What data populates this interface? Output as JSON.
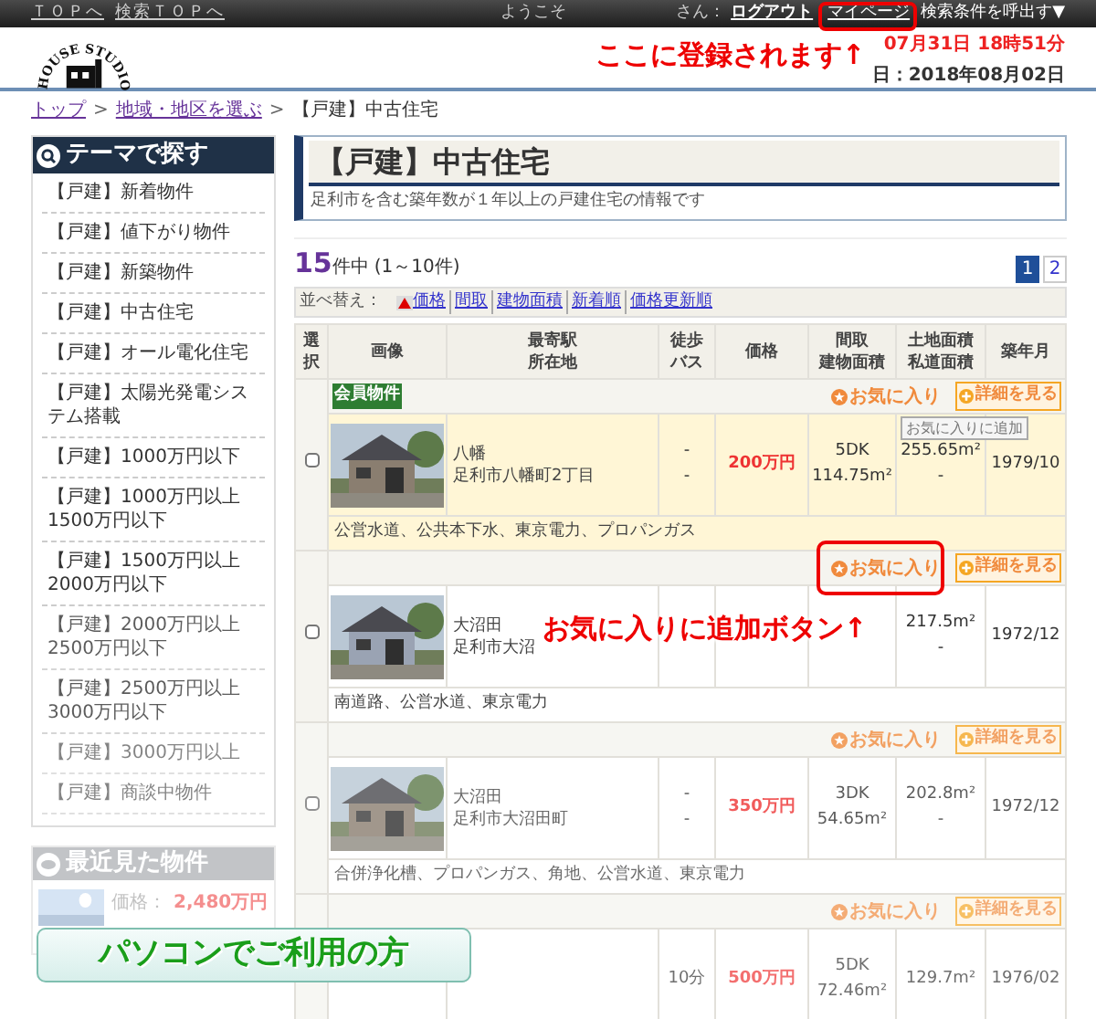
{
  "top_bar": {
    "links": [
      "ＴＯＰへ",
      "検索ＴＯＰへ"
    ],
    "welcome": "ようこそ",
    "san": "さん：",
    "logout": "ログアウト",
    "mypage": "マイページ",
    "saved_search": "検索条件を呼出す▼"
  },
  "header": {
    "logo": "HOUSE STUDIO",
    "update_line": "07月31日 18時51分",
    "next_update_line": "日：2018年08月02日"
  },
  "breadcrumb": {
    "separator": ">",
    "items": [
      {
        "label": "トップ",
        "link": true
      },
      {
        "label": "地域・地区を選ぶ",
        "link": true
      },
      {
        "label": "【戸建】中古住宅",
        "link": false
      }
    ]
  },
  "sidebar": {
    "theme_title": "テーマで探す",
    "items": [
      "【戸建】新着物件",
      "【戸建】値下がり物件",
      "【戸建】新築物件",
      "【戸建】中古住宅",
      "【戸建】オール電化住宅",
      "【戸建】太陽光発電システム搭載",
      "【戸建】1000万円以下",
      "【戸建】1000万円以上1500万円以下",
      "【戸建】1500万円以上2000万円以下",
      "【戸建】2000万円以上2500万円以下",
      "【戸建】2500万円以上3000万円以下",
      "【戸建】3000万円以上",
      "【戸建】商談中物件"
    ],
    "recent_title": "最近見た物件",
    "recent_price_label": "価格：",
    "recent_price": "2,480万円"
  },
  "page": {
    "title": "【戸建】中古住宅",
    "description": "足利市を含む築年数が１年以上の戸建住宅の情報です"
  },
  "result": {
    "count": "15",
    "count_suffix": "件中",
    "range": "(1～10件)",
    "pages": [
      {
        "label": "1",
        "selected": true
      },
      {
        "label": "2",
        "selected": false
      }
    ]
  },
  "sort": {
    "label": "並べ替え：",
    "options": [
      {
        "label": "価格",
        "arrow": true
      },
      {
        "label": "間取",
        "arrow": false
      },
      {
        "label": "建物面積",
        "arrow": false
      },
      {
        "label": "新着順",
        "arrow": false
      },
      {
        "label": "価格更新順",
        "arrow": false
      }
    ]
  },
  "table": {
    "columns": [
      {
        "lines": [
          "選",
          "択"
        ]
      },
      {
        "lines": [
          "画像"
        ]
      },
      {
        "lines": [
          "最寄駅",
          "所在地"
        ]
      },
      {
        "lines": [
          "徒歩",
          "バス"
        ]
      },
      {
        "lines": [
          "価格"
        ]
      },
      {
        "lines": [
          "間取",
          "建物面積"
        ]
      },
      {
        "lines": [
          "土地面積",
          "私道面積"
        ]
      },
      {
        "lines": [
          "築年月"
        ]
      }
    ],
    "rows": [
      {
        "member_badge": "会員物件",
        "favorite": "お気に入り",
        "details": "詳細を見る",
        "highlighted": true,
        "checked": false,
        "station": "八幡",
        "address": "足利市八幡町2丁目",
        "walk": "-",
        "bus": "-",
        "price": "200万円",
        "layout": "5DK",
        "building_area": "114.75m²",
        "land_area": "255.65m²",
        "private_road": "-",
        "built": "1979/10",
        "note": "公営水道、公共本下水、東京電力、プロパンガス"
      },
      {
        "favorite": "お気に入り",
        "details": "詳細を見る",
        "highlighted": false,
        "checked": false,
        "station": "大沼田",
        "address": "足利市大沼",
        "land_area": "217.5m²",
        "private_road": "-",
        "built": "1972/12",
        "note": "南道路、公営水道、東京電力"
      },
      {
        "favorite": "お気に入り",
        "details": "詳細を見る",
        "highlighted": false,
        "checked": false,
        "station": "大沼田",
        "address": "足利市大沼田町",
        "walk": "-",
        "bus": "-",
        "price": "350万円",
        "layout": "3DK",
        "building_area": "54.65m²",
        "land_area": "202.8m²",
        "private_road": "-",
        "built": "1972/12",
        "note": "合併浄化槽、プロパンガス、角地、公営水道、東京電力"
      },
      {
        "favorite": "お気に入り",
        "details": "詳細を見る",
        "walk": "10分",
        "price": "500万円",
        "layout": "5DK",
        "building_area": "72.46m²",
        "land_area": "129.7m²",
        "built": "1976/02"
      }
    ]
  },
  "tooltip": "お気に入りに追加",
  "annotations": [
    "ここに登録されます↑",
    "お気に入りに追加ボタン↑"
  ],
  "banner": "パソコンでご利用の方"
}
